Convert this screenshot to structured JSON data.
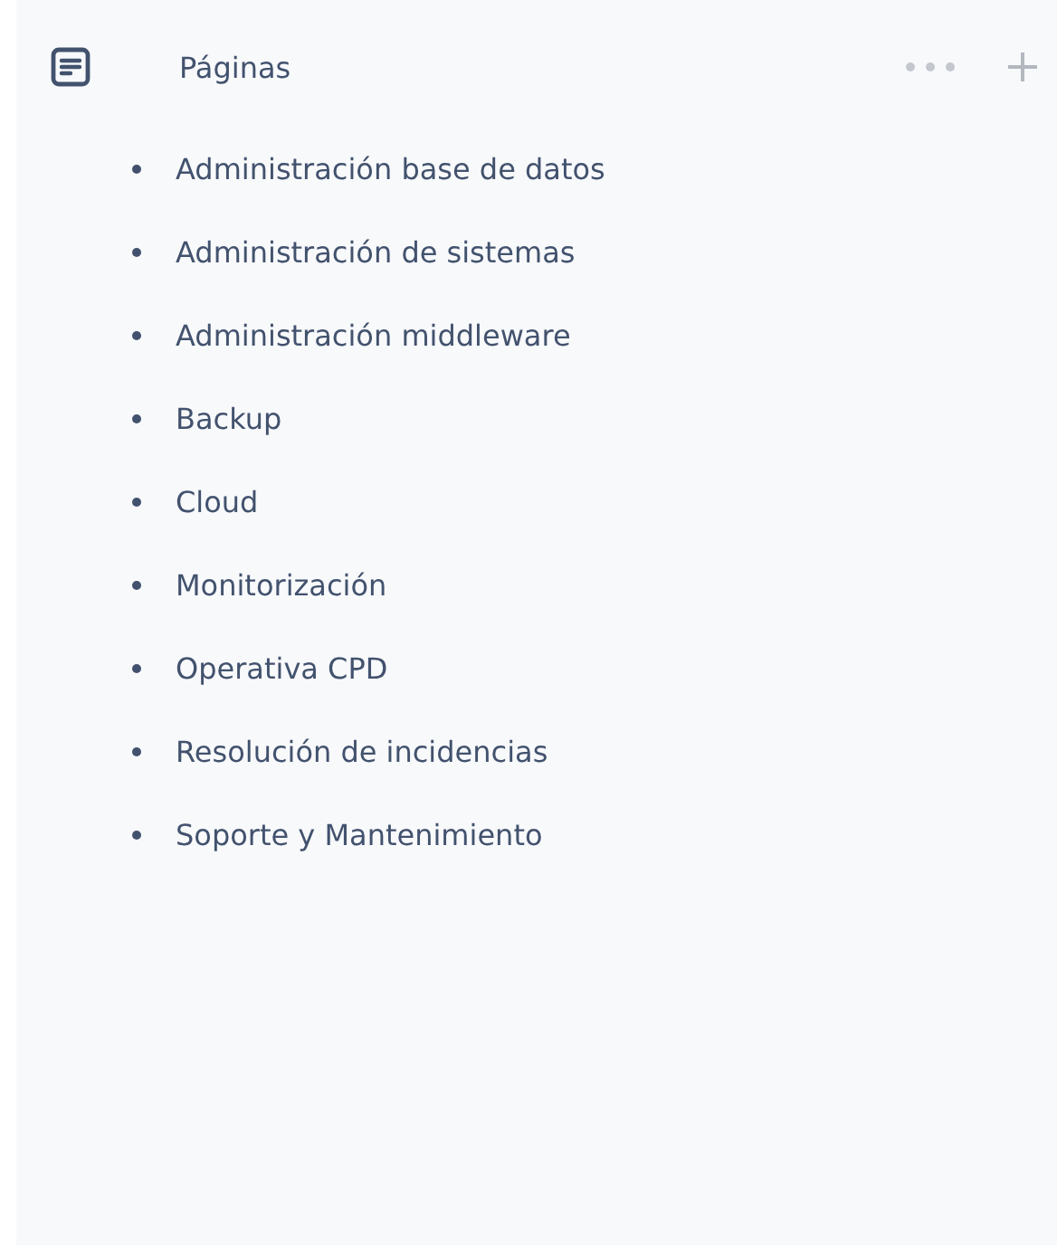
{
  "section": {
    "title": "Páginas"
  },
  "pages": [
    {
      "title": "Administración base de datos"
    },
    {
      "title": "Administración de sistemas"
    },
    {
      "title": "Administración middleware"
    },
    {
      "title": "Backup"
    },
    {
      "title": "Cloud"
    },
    {
      "title": "Monitorización"
    },
    {
      "title": "Operativa CPD"
    },
    {
      "title": "Resolución de incidencias"
    },
    {
      "title": "Soporte y Mantenimiento"
    }
  ]
}
